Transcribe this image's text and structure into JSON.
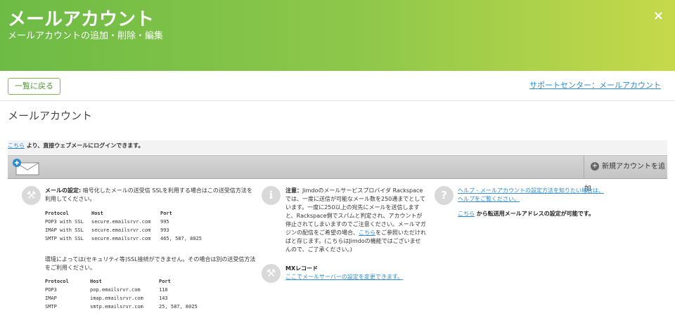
{
  "header": {
    "title": "メールアカウント",
    "subtitle": "メールアカウントの追加・削除・編集",
    "close": "×"
  },
  "toolbar": {
    "back_label": "一覧に戻る",
    "support_link": "サポートセンター：メールアカウント"
  },
  "section_title": "メールアカウント",
  "webmail": {
    "link": "こちら",
    "rest": " より、直接ウェブメールにログインできます。"
  },
  "bar": {
    "add_label": "新規アカウントを追加",
    "add_icon": "plus-circle-icon",
    "mail_icon": "envelope-plus-icon"
  },
  "mail_settings": {
    "icon": "wrench-icon",
    "intro_bold": "メールの設定:",
    "intro": " 暗号化したメールの送受信 SSLを利用する場合はこの送受信方法を利用してください。",
    "ssl_table": {
      "headers": [
        "Protocol",
        "Host",
        "Port"
      ],
      "rows": [
        [
          "POP3 with SSL",
          "secure.emailsrvr.com",
          "995"
        ],
        [
          "IMAP with SSL",
          "secure.emailsrvr.com",
          "993"
        ],
        [
          "SMTP with SSL",
          "secure.emailsrvr.com",
          "465, 587, 8025"
        ]
      ]
    },
    "non_ssl_note": "環境によっては(セキュリティ等)SSL接続ができません。その場合は別の送受信方法をご利用ください。",
    "plain_table": {
      "headers": [
        "Protocol",
        "Host",
        "Port"
      ],
      "rows": [
        [
          "POP3",
          "pop.emailsrvr.com",
          "110"
        ],
        [
          "IMAP",
          "imap.emailsrvr.com",
          "143"
        ],
        [
          "SMTP",
          "smtp.emailsrvr.com",
          "25, 587, 8025"
        ]
      ]
    }
  },
  "notice": {
    "icon": "info-icon",
    "bold": "注意：",
    "text1": "Jimdoのメールサービスプロバイダ Rackspace では、一度に送信が可能なメール数を250通までとしています。一度に250以上の宛先にメールを送信しますと、Rackspace側でスパムと判定され、アカウントが停止されてしまいますのでご注意ください。メールマガジンの配信をご希望の場合、",
    "link": "こちら",
    "text2": "をご参照いただければと存じます。(こちらはJimdoの機能ではございませんので、ご了承ください。)"
  },
  "mx": {
    "icon": "wrench-icon",
    "title": "MXレコード",
    "link": "ここでメールサーバーの設定を変更できます。"
  },
  "help": {
    "icon": "question-icon",
    "link": "ヘルプ - メールアカウントの設定方法を知りたい場合は、ヘルプをご覧ください。",
    "forward_link": "こちら",
    "forward_text": " から転送用メールアドレスの設定が可能です。"
  }
}
